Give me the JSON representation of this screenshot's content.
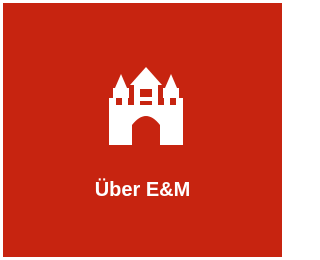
{
  "tile": {
    "label": "Über E&M",
    "icon": "castle-gate-icon",
    "background_color": "#c72410",
    "text_color": "#ffffff"
  }
}
